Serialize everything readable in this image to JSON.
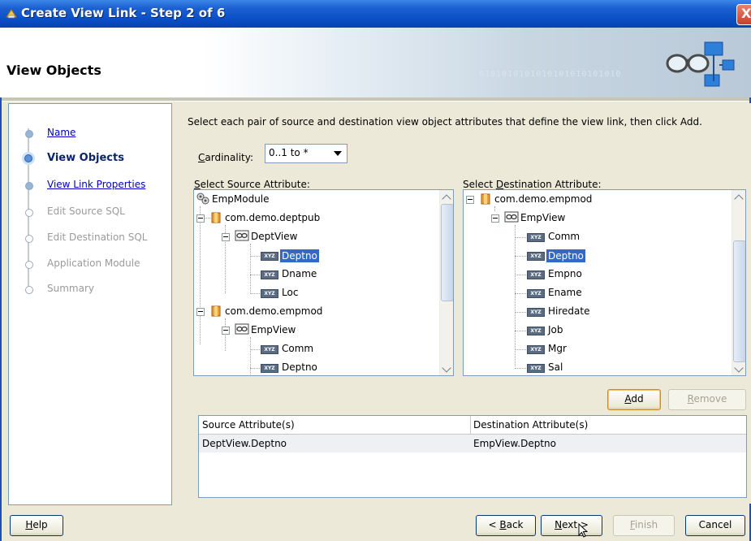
{
  "window": {
    "title": "Create View Link - Step 2 of 6",
    "close_label": "X"
  },
  "header": {
    "title": "View Objects",
    "binary_text": "0101010101010101010101010"
  },
  "nav": {
    "items": [
      {
        "label": "Name",
        "state": "done"
      },
      {
        "label": "View Objects",
        "state": "current"
      },
      {
        "label": "View Link Properties",
        "state": "done"
      },
      {
        "label": "Edit Source SQL",
        "state": "disabled"
      },
      {
        "label": "Edit Destination SQL",
        "state": "disabled"
      },
      {
        "label": "Application Module",
        "state": "disabled"
      },
      {
        "label": "Summary",
        "state": "disabled"
      }
    ]
  },
  "main": {
    "instruction": "Select each pair of source and destination view object attributes that define the view link, then click Add.",
    "cardinality_label_pre": "C",
    "cardinality_label_post": "ardinality:",
    "cardinality_value": "0..1 to *",
    "source_label_pre": "S",
    "source_label_post": "elect Source Attribute:",
    "dest_label_pre": "Select ",
    "dest_label_u": "D",
    "dest_label_post": "estination Attribute:"
  },
  "source_tree": {
    "module": "EmpModule",
    "pkg1": "com.demo.deptpub",
    "view1": "DeptView",
    "view1_attrs": [
      "Deptno",
      "Dname",
      "Loc"
    ],
    "pkg2": "com.demo.empmod",
    "view2": "EmpView",
    "view2_attrs": [
      "Comm",
      "Deptno"
    ],
    "selected": "Deptno"
  },
  "dest_tree": {
    "pkg": "com.demo.empmod",
    "view": "EmpView",
    "attrs": [
      "Comm",
      "Deptno",
      "Empno",
      "Ename",
      "Hiredate",
      "Job",
      "Mgr",
      "Sal"
    ],
    "selected": "Deptno"
  },
  "attr_icon_text": "XYZ",
  "buttons": {
    "add_u": "A",
    "add_rest": "dd",
    "remove_u": "R",
    "remove_rest": "emove",
    "help_u": "H",
    "help_rest": "elp",
    "back_pre": "< ",
    "back_u": "B",
    "back_rest": "ack",
    "next_u": "N",
    "next_rest": "ext >",
    "finish_u": "F",
    "finish_rest": "inish",
    "cancel": "Cancel"
  },
  "grid": {
    "col1": "Source Attribute(s)",
    "col2": "Destination Attribute(s)",
    "rows": [
      {
        "source": "DeptView.Deptno",
        "dest": "EmpView.Deptno"
      }
    ]
  },
  "colors": {
    "titlebar": "#0a4fc6",
    "selection": "#316ac5",
    "link": "#0000cc"
  }
}
